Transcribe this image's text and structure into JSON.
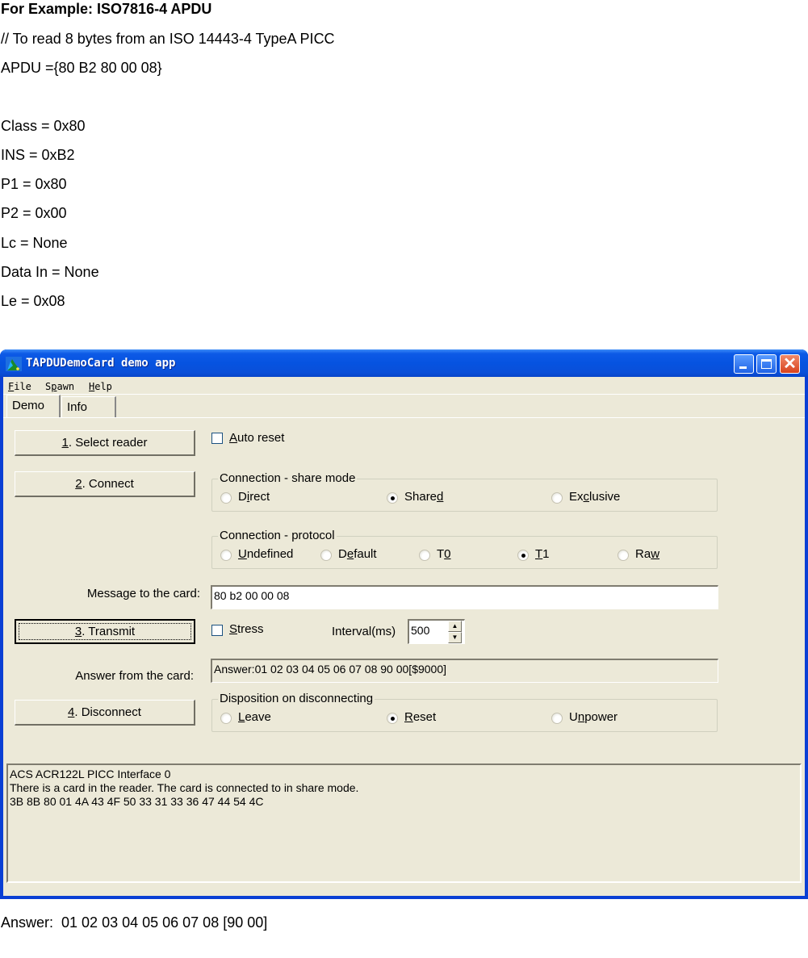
{
  "document": {
    "heading": "For Example: ISO7816-4 APDU",
    "comment": "// To read 8 bytes from an ISO 14443-4 TypeA PICC",
    "apdu_line": "APDU ={80 B2 80 00 08}",
    "fields": [
      "Class = 0x80",
      "INS = 0xB2",
      "P1 = 0x80",
      "P2 = 0x00",
      "Lc = None",
      "Data In = None",
      "Le = 0x08"
    ],
    "answer_line": "Answer:  01 02 03 04 05 06 07 08 [90 00]"
  },
  "window": {
    "title": "TAPDUDemoCard demo app",
    "menu": [
      {
        "pre": "",
        "u": "F",
        "post": "ile"
      },
      {
        "pre": "S",
        "u": "p",
        "post": "awn"
      },
      {
        "pre": "",
        "u": "H",
        "post": "elp"
      }
    ],
    "tabs": [
      {
        "label": "Demo",
        "active": true
      },
      {
        "label": "Info",
        "active": false
      }
    ],
    "buttons": {
      "select_reader": {
        "u": "1",
        "rest": ". Select reader"
      },
      "connect": {
        "u": "2",
        "rest": ". Connect"
      },
      "transmit": {
        "u": "3",
        "rest": ". Transmit"
      },
      "disconnect": {
        "u": "4",
        "rest": ". Disconnect"
      }
    },
    "auto_reset": {
      "u": "A",
      "rest": "uto reset",
      "checked": false
    },
    "share_mode": {
      "title": "Connection - share mode",
      "options": [
        {
          "pre": "D",
          "u": "i",
          "post": "rect",
          "checked": false
        },
        {
          "pre": "Share",
          "u": "d",
          "post": "",
          "checked": true
        },
        {
          "pre": "Ex",
          "u": "c",
          "post": "lusive",
          "checked": false
        }
      ]
    },
    "protocol": {
      "title": "Connection - protocol",
      "options": [
        {
          "pre": "",
          "u": "U",
          "post": "ndefined",
          "checked": false
        },
        {
          "pre": "D",
          "u": "e",
          "post": "fault",
          "checked": false
        },
        {
          "pre": "T",
          "u": "0",
          "post": "",
          "checked": false
        },
        {
          "pre": "",
          "u": "T",
          "post": "1",
          "checked": true
        },
        {
          "pre": "Ra",
          "u": "w",
          "post": "",
          "checked": false
        }
      ]
    },
    "message_label": "Message to the card:",
    "message_value": "80 b2 00 00 08",
    "stress": {
      "u": "S",
      "rest": "tress",
      "checked": false
    },
    "interval_label": "Interval(ms)",
    "interval_value": "500",
    "answer_label": "Answer from the card:",
    "answer_value": "Answer:01 02 03 04 05 06 07 08 90 00[$9000]",
    "disposition": {
      "title": "Disposition on disconnecting",
      "options": [
        {
          "pre": "",
          "u": "L",
          "post": "eave",
          "checked": false
        },
        {
          "pre": "",
          "u": "R",
          "post": "eset",
          "checked": true
        },
        {
          "pre": "U",
          "u": "n",
          "post": "power",
          "checked": false
        }
      ]
    },
    "log_lines": [
      "ACS ACR122L PICC Interface 0",
      "There is a card in the reader. The card is connected to in share mode.",
      "3B 8B 80 01 4A 43 4F 50 33 31 33 36 47 44 54 4C"
    ]
  }
}
